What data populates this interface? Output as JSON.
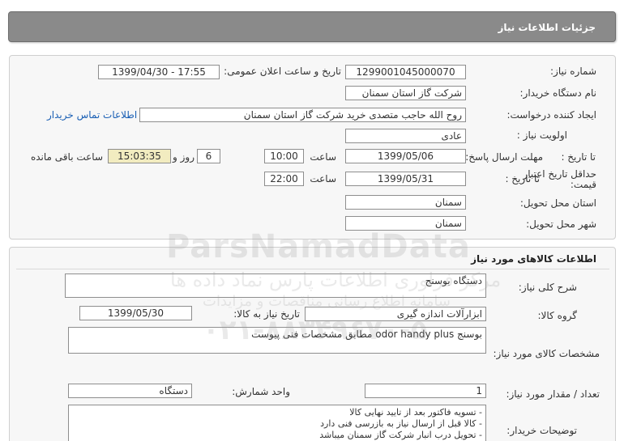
{
  "header": {
    "title": "جزئیات اطلاعات نیاز"
  },
  "need": {
    "number_label": "شماره نیاز:",
    "number_value": "1299001045000070",
    "announce_label": "تاریخ و ساعت اعلان عمومی:",
    "announce_value": "1399/04/30 - 17:55",
    "buyer_label": "نام دستگاه خریدار:",
    "buyer_value": "شرکت گاز استان سمنان",
    "creator_label": "ایجاد کننده درخواست:",
    "creator_value": "روح الله  حاجب متصدی خرید شرکت گاز استان سمنان",
    "contact_link": "اطلاعات تماس خریدار",
    "priority_label": "اولویت نیاز :",
    "priority_value": "عادی",
    "deadline_label": "مهلت ارسال پاسخ:",
    "until_date_label": "تا تاریخ :",
    "deadline_date": "1399/05/06",
    "time_label": "ساعت",
    "deadline_time": "10:00",
    "days_value": "6",
    "days_label": "روز و",
    "remaining_value": "15:03:35",
    "remaining_label": "ساعت باقی مانده",
    "validity_label": "حداقل تاریخ اعتبار قیمت:",
    "validity_date": "1399/05/31",
    "validity_time": "22:00",
    "province_label": "استان محل تحویل:",
    "province_value": "سمنان",
    "city_label": "شهر محل تحویل:",
    "city_value": "سمنان"
  },
  "goods": {
    "section_title": "اطلاعات کالاهای مورد نیاز",
    "desc_label": "شرح کلی نیاز:",
    "desc_value": "دستگاه بوسنج",
    "group_label": "گروه کالا:",
    "group_value": "ابزارآلات اندازه گیری",
    "need_date_label": "تاریخ نیاز به کالا:",
    "need_date_value": "1399/05/30",
    "spec_label": "مشخصات کالای مورد نیاز:",
    "spec_value": "بوسنج odor handy plus  مطابق مشخصات فنی پیوست",
    "qty_label": "تعداد / مقدار مورد نیاز:",
    "qty_value": "1",
    "unit_label": "واحد شمارش:",
    "unit_value": "دستگاه",
    "buyer_notes_label": "توضیحات خریدار:",
    "notes": [
      "- تسویه فاکتور بعد از تایید نهایی کالا",
      "- کالا قبل از ارسال نیاز به بازرسی فنی دارد",
      "- تحویل درب انبار شرکت گاز سمنان میباشد"
    ]
  },
  "watermark": {
    "brand": "ParsNamadData",
    "line1": "مرکز فراوری اطلاعات پارس نماد داده ها",
    "line2": "سامانه اطلاع رسانی مناقصات و مزایدات",
    "phone": "۰۲۱-۸۸۳۴۹۶۷۰-۵"
  }
}
